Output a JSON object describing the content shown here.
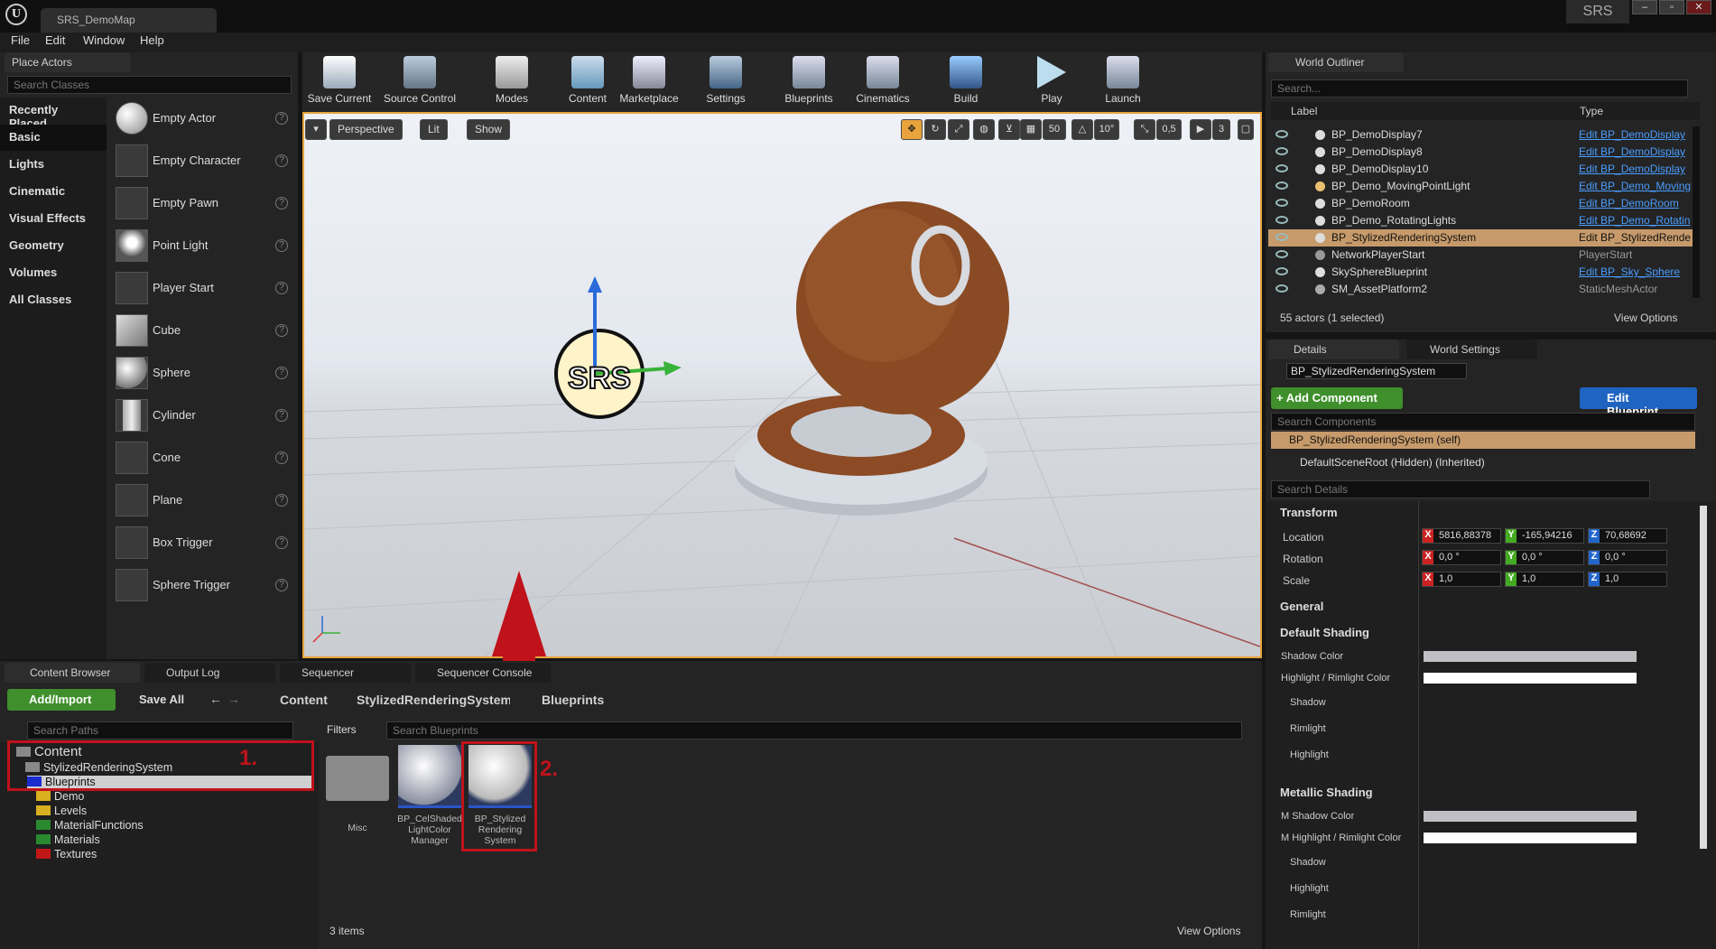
{
  "window": {
    "tab": "SRS_DemoMap",
    "badge": "SRS",
    "min": "–",
    "max": "▫",
    "close": "✕"
  },
  "menu": [
    "File",
    "Edit",
    "Window",
    "Help"
  ],
  "place_actors": {
    "title": "Place Actors",
    "search_placeholder": "Search Classes",
    "categories": [
      "Recently Placed",
      "Basic",
      "Lights",
      "Cinematic",
      "Visual Effects",
      "Geometry",
      "Volumes",
      "All Classes"
    ],
    "actors": [
      "Empty Actor",
      "Empty Character",
      "Empty Pawn",
      "Point Light",
      "Player Start",
      "Cube",
      "Sphere",
      "Cylinder",
      "Cone",
      "Plane",
      "Box Trigger",
      "Sphere Trigger"
    ]
  },
  "toolbar": [
    "Save Current",
    "Source Control",
    "Modes",
    "Content",
    "Marketplace",
    "Settings",
    "Blueprints",
    "Cinematics",
    "Build",
    "Play",
    "Launch"
  ],
  "viewport": {
    "perspective": "Perspective",
    "lit": "Lit",
    "show": "Show",
    "grid": "50",
    "angle": "10°",
    "scale": "0,5",
    "speed": "3",
    "logo": "SRS"
  },
  "outliner": {
    "title": "World Outliner",
    "search_placeholder": "Search...",
    "col_label": "Label",
    "col_type": "Type",
    "rows": [
      {
        "name": "BP_DemoDisplay7",
        "type": "Edit BP_DemoDisplay",
        "link": true
      },
      {
        "name": "BP_DemoDisplay8",
        "type": "Edit BP_DemoDisplay",
        "link": true
      },
      {
        "name": "BP_DemoDisplay10",
        "type": "Edit BP_DemoDisplay",
        "link": true
      },
      {
        "name": "BP_Demo_MovingPointLight",
        "type": "Edit BP_Demo_Moving",
        "link": true
      },
      {
        "name": "BP_DemoRoom",
        "type": "Edit BP_DemoRoom",
        "link": true
      },
      {
        "name": "BP_Demo_RotatingLights",
        "type": "Edit BP_Demo_Rotatin",
        "link": true
      },
      {
        "name": "BP_StylizedRenderingSystem",
        "type": "Edit BP_StylizedRende",
        "link": false
      },
      {
        "name": "NetworkPlayerStart",
        "type": "PlayerStart",
        "link": false
      },
      {
        "name": "SkySphereBlueprint",
        "type": "Edit BP_Sky_Sphere",
        "link": true
      },
      {
        "name": "SM_AssetPlatform2",
        "type": "StaticMeshActor",
        "link": false
      }
    ],
    "status": "55 actors (1 selected)",
    "view_options": "View Options"
  },
  "details": {
    "tab": "Details",
    "tab2": "World Settings",
    "actor": "BP_StylizedRenderingSystem",
    "add_component": "+ Add Component",
    "edit_blueprint": "Edit Blueprint",
    "search_components": "Search Components",
    "self": "BP_StylizedRenderingSystem (self)",
    "root": "DefaultSceneRoot (Hidden) (Inherited)",
    "search_details": "Search Details",
    "transform": "Transform",
    "location": "Location",
    "rotation": "Rotation",
    "scale": "Scale",
    "loc": [
      "5816,88378",
      "-165,94216",
      "70,68692"
    ],
    "rot": [
      "0,0 °",
      "0,0 °",
      "0,0 °"
    ],
    "scl": [
      "1,0",
      "1,0",
      "1,0"
    ],
    "general": "General",
    "default_shading": "Default Shading",
    "shadow_color": "Shadow Color",
    "highlight_rim": "Highlight / Rimlight Color",
    "shadow": "Shadow",
    "rimlight": "Rimlight",
    "highlight": "Highlight",
    "metallic_shading": "Metallic Shading",
    "m_shadow": "M Shadow Color",
    "m_highlight": "M Highlight / Rimlight Color",
    "highlight2": "Highlight",
    "rimlight2": "Rimlight",
    "shadow2": "Shadow"
  },
  "bottom_tabs": [
    "Content Browser",
    "Output Log",
    "Sequencer",
    "Sequencer Console"
  ],
  "content_browser": {
    "add_import": "Add/Import",
    "save_all": "Save All",
    "crumbs": [
      "Content",
      "StylizedRenderingSystem",
      "Blueprints"
    ],
    "search_paths": "Search Paths",
    "filters": "Filters",
    "search_blueprints": "Search Blueprints",
    "tree": {
      "root": "Content",
      "sub": "StylizedRenderingSystem",
      "children": [
        "Blueprints",
        "Demo",
        "Levels",
        "MaterialFunctions",
        "Materials",
        "Textures"
      ]
    },
    "assets": [
      {
        "label": "Misc"
      },
      {
        "label": "BP_CelShaded LightColor Manager"
      },
      {
        "label": "BP_Stylized Rendering System"
      }
    ],
    "count": "3 items",
    "view_options": "View Options",
    "step1": "1.",
    "step2": "2."
  },
  "colors": {
    "accent_orange": "#e8a33d",
    "selection": "#c69a6a",
    "annotation_red": "#c0121a",
    "link_blue": "#4a9dff",
    "add_green": "#3f8f2c",
    "edit_blue": "#1f64c0"
  }
}
